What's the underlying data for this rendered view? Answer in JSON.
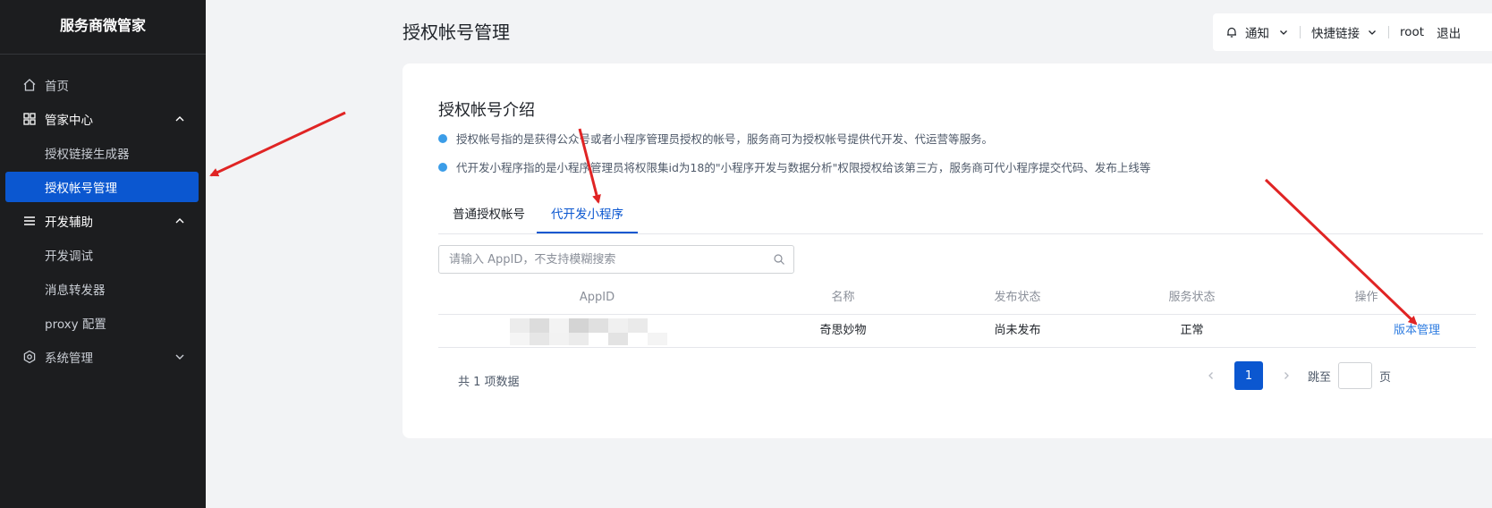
{
  "sidebar": {
    "brand": "服务商微管家",
    "items": [
      {
        "label": "首页",
        "icon": "home-icon"
      },
      {
        "label": "管家中心",
        "icon": "grid-icon",
        "expanded": true
      },
      {
        "label": "授权链接生成器"
      },
      {
        "label": "授权帐号管理",
        "active": true
      },
      {
        "label": "开发辅助",
        "icon": "list-icon",
        "expanded": true
      },
      {
        "label": "开发调试"
      },
      {
        "label": "消息转发器"
      },
      {
        "label": "proxy 配置"
      },
      {
        "label": "系统管理",
        "icon": "hexagon-settings-icon",
        "expanded": false
      }
    ]
  },
  "header": {
    "title": "授权帐号管理",
    "notify": "通知",
    "quick_links": "快捷链接",
    "user": "root",
    "logout": "退出"
  },
  "card": {
    "title": "授权帐号介绍",
    "bullets": [
      "授权帐号指的是获得公众号或者小程序管理员授权的帐号，服务商可为授权帐号提供代开发、代运营等服务。",
      "代开发小程序指的是小程序管理员将权限集id为18的\"小程序开发与数据分析\"权限授权给该第三方，服务商可代小程序提交代码、发布上线等"
    ],
    "tabs": [
      {
        "label": "普通授权帐号",
        "active": false
      },
      {
        "label": "代开发小程序",
        "active": true
      }
    ],
    "search": {
      "placeholder": "请输入 AppID，不支持模糊搜索",
      "value": ""
    }
  },
  "table": {
    "columns": [
      "AppID",
      "名称",
      "发布状态",
      "服务状态",
      "操作"
    ],
    "rows": [
      {
        "appid": "",
        "name": "奇思妙物",
        "publish_status": "尚未发布",
        "service_status": "正常",
        "action": "版本管理"
      }
    ]
  },
  "pagination": {
    "total_text": "共 1 项数据",
    "current_page": "1",
    "jump_label": "跳至",
    "page_suffix": "页"
  },
  "colors": {
    "sidebar_bg": "#1c1d1f",
    "active_bg": "#0b57d0",
    "link": "#2f7de1",
    "annotation_arrow": "#e02424"
  }
}
